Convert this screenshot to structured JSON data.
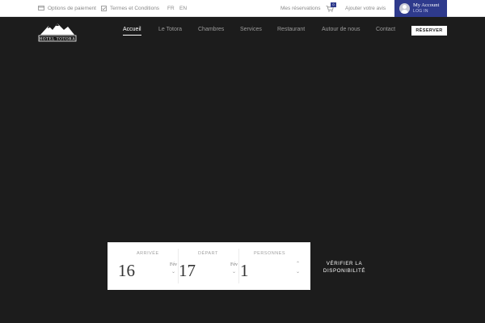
{
  "topbar": {
    "payment_options": "Options de paiement",
    "terms": "Termes et Conditions",
    "lang_fr": "FR",
    "lang_en": "EN",
    "my_reservations": "Mes réservations",
    "cart_count": "0",
    "add_review": "Ajouter votre avis",
    "account_title": "My Account",
    "account_login": "LOG IN"
  },
  "logo": {
    "text": "HOTEL TOTORA"
  },
  "nav": {
    "items": [
      "Accueil",
      "Le Totora",
      "Chambres",
      "Services",
      "Restaurant",
      "Autour de nous",
      "Contact"
    ],
    "reserve": "RÉSERVER"
  },
  "booking": {
    "arrival_label": "ARRIVÉE",
    "arrival_day": "16",
    "arrival_month": "Fév",
    "departure_label": "DÉPART",
    "departure_day": "17",
    "departure_month": "Fév",
    "persons_label": "PERSONNES",
    "persons_value": "1",
    "check_line1": "VÉRIFIER LA",
    "check_line2": "DISPONIBILITÉ"
  },
  "colors": {
    "hero_bg": "#1c1c1c",
    "account_bg": "#2e3a8c",
    "topbar_bg": "#ffffff"
  }
}
